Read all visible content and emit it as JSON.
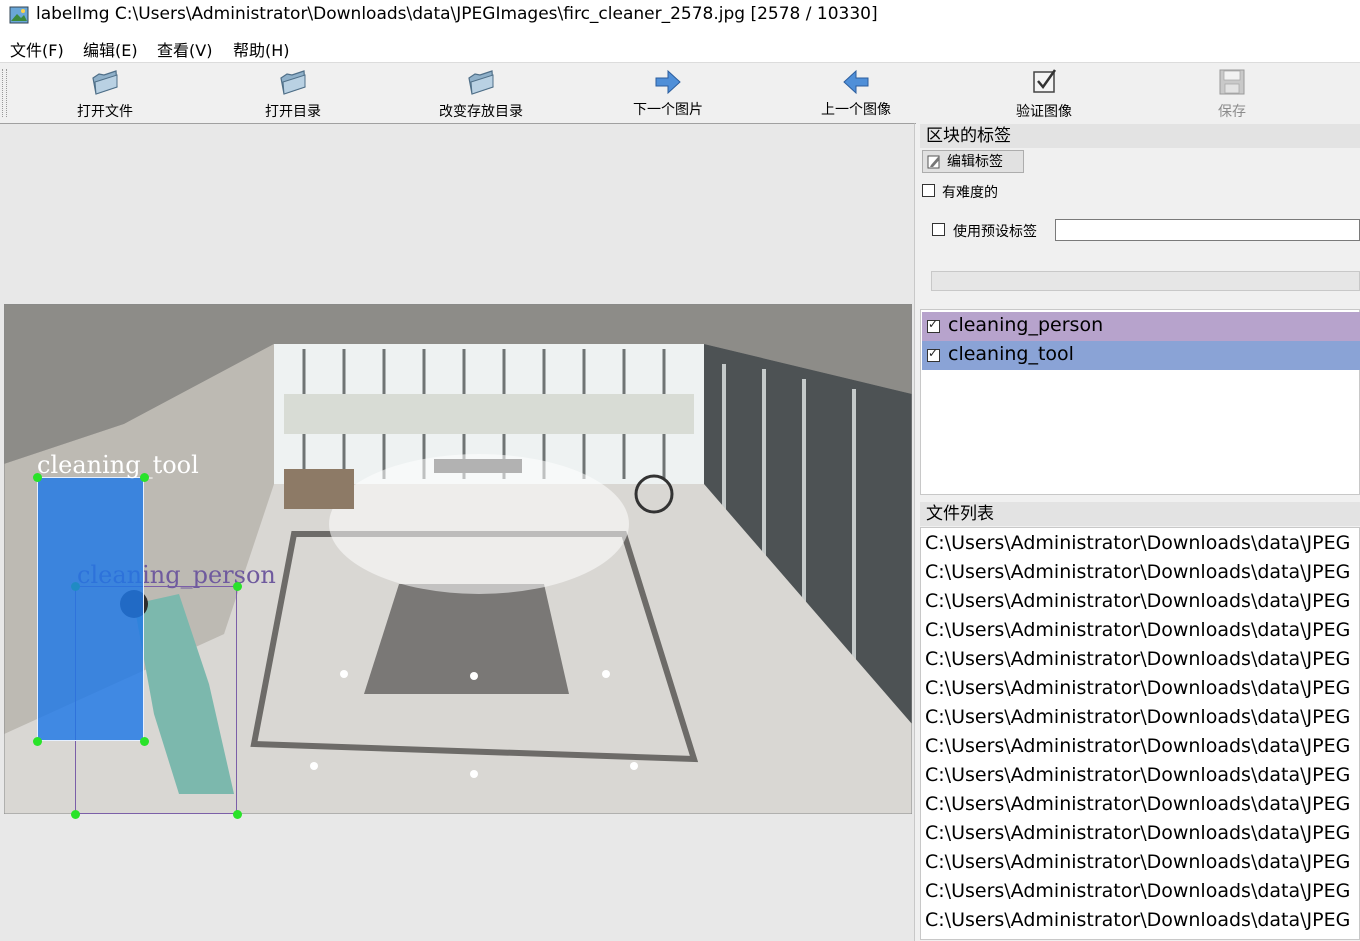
{
  "window": {
    "title": "labelImg C:\\Users\\Administrator\\Downloads\\data\\JPEGImages\\firc_cleaner_2578.jpg [2578 / 10330]"
  },
  "menu": [
    "文件(F)",
    "编辑(E)",
    "查看(V)",
    "帮助(H)"
  ],
  "toolbar": {
    "open_file": "打开文件",
    "open_dir": "打开目录",
    "change_save_dir": "改变存放目录",
    "next_image": "下一个图片",
    "prev_image": "上一个图像",
    "verify_image": "验证图像",
    "save": "保存"
  },
  "canvas": {
    "boxes": [
      {
        "label": "cleaning_tool",
        "color": "#4a90e2"
      },
      {
        "label": "cleaning_person",
        "color": "#7b5fa8"
      }
    ]
  },
  "right_panel": {
    "box_labels_title": "区块的标签",
    "edit_label_button": "编辑标签",
    "difficult_label": "有难度的",
    "use_default_label": "使用预设标签",
    "default_label_value": "",
    "labels": [
      {
        "text": "cleaning_person",
        "checked": true,
        "color": "#b7a3cc"
      },
      {
        "text": "cleaning_tool",
        "checked": true,
        "color": "#8aa3d6"
      }
    ],
    "file_list_title": "文件列表",
    "files": [
      "C:\\Users\\Administrator\\Downloads\\data\\JPEG",
      "C:\\Users\\Administrator\\Downloads\\data\\JPEG",
      "C:\\Users\\Administrator\\Downloads\\data\\JPEG",
      "C:\\Users\\Administrator\\Downloads\\data\\JPEG",
      "C:\\Users\\Administrator\\Downloads\\data\\JPEG",
      "C:\\Users\\Administrator\\Downloads\\data\\JPEG",
      "C:\\Users\\Administrator\\Downloads\\data\\JPEG",
      "C:\\Users\\Administrator\\Downloads\\data\\JPEG",
      "C:\\Users\\Administrator\\Downloads\\data\\JPEG",
      "C:\\Users\\Administrator\\Downloads\\data\\JPEG",
      "C:\\Users\\Administrator\\Downloads\\data\\JPEG",
      "C:\\Users\\Administrator\\Downloads\\data\\JPEG",
      "C:\\Users\\Administrator\\Downloads\\data\\JPEG",
      "C:\\Users\\Administrator\\Downloads\\data\\JPEG"
    ]
  }
}
